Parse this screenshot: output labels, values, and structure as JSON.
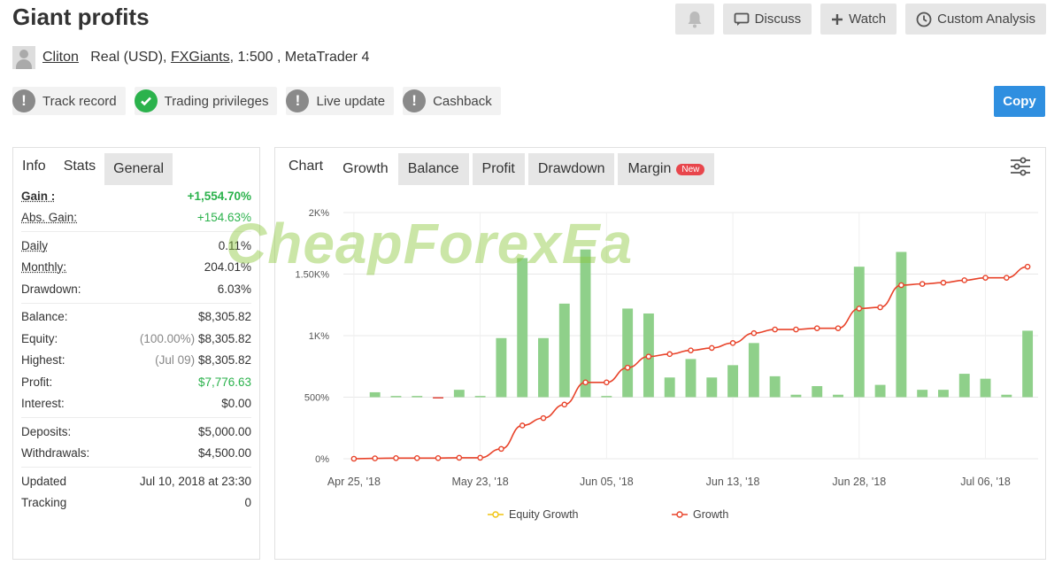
{
  "header": {
    "title": "Giant profits",
    "buttons": {
      "discuss": "Discuss",
      "watch": "Watch",
      "custom_analysis": "Custom Analysis"
    }
  },
  "account": {
    "user": "Cliton",
    "type": "Real (USD),",
    "broker": "FXGiants",
    "leverage_platform": ", 1:500 , MetaTrader 4"
  },
  "badges": [
    {
      "label": "Track record",
      "status": "warning"
    },
    {
      "label": "Trading privileges",
      "status": "ok"
    },
    {
      "label": "Live update",
      "status": "warning"
    },
    {
      "label": "Cashback",
      "status": "warning"
    }
  ],
  "copy_label": "Copy",
  "left_tabs": [
    "Info",
    "Stats",
    "General"
  ],
  "stats": {
    "gain": {
      "label": "Gain :",
      "value": "+1,554.70%"
    },
    "abs_gain": {
      "label": "Abs. Gain:",
      "value": "+154.63%"
    },
    "daily": {
      "label": "Daily",
      "value": "0.11%"
    },
    "monthly": {
      "label": "Monthly:",
      "value": "204.01%"
    },
    "drawdown": {
      "label": "Drawdown:",
      "value": "6.03%"
    },
    "balance": {
      "label": "Balance:",
      "value": "$8,305.82"
    },
    "equity": {
      "label": "Equity:",
      "prefix": "(100.00%)",
      "value": "$8,305.82"
    },
    "highest": {
      "label": "Highest:",
      "prefix": "(Jul 09)",
      "value": "$8,305.82"
    },
    "profit": {
      "label": "Profit:",
      "value": "$7,776.63"
    },
    "interest": {
      "label": "Interest:",
      "value": "$0.00"
    },
    "deposits": {
      "label": "Deposits:",
      "value": "$5,000.00"
    },
    "withdrawals": {
      "label": "Withdrawals:",
      "value": "$4,500.00"
    },
    "updated": {
      "label": "Updated",
      "value": "Jul 10, 2018 at 23:30"
    },
    "tracking": {
      "label": "Tracking",
      "value": "0"
    }
  },
  "right_tabs": {
    "label": "Chart",
    "tabs": [
      "Growth",
      "Balance",
      "Profit",
      "Drawdown",
      "Margin"
    ],
    "new_badge": "New"
  },
  "watermark": "CheapForexEa",
  "colors": {
    "accent": "#2f8fe0",
    "positive": "#2bb24c",
    "growth_line": "#e8432a",
    "equity_line": "#f1c40f",
    "bar_pos": "#8fd08a",
    "bar_neg": "#e0453a"
  },
  "chart_data": {
    "type": "bar",
    "ylim": [
      0,
      2000
    ],
    "y_ticks": [
      0,
      500,
      1000,
      1500,
      2000
    ],
    "y_tick_labels": [
      "0%",
      "500%",
      "1K%",
      "1.50K%",
      "2K%"
    ],
    "x_tick_labels": [
      {
        "index": 0,
        "label": "Apr 25, '18"
      },
      {
        "index": 6,
        "label": "May 23, '18"
      },
      {
        "index": 12,
        "label": "Jun 05, '18"
      },
      {
        "index": 18,
        "label": "Jun 13, '18"
      },
      {
        "index": 24,
        "label": "Jun 28, '18"
      },
      {
        "index": 30,
        "label": "Jul 06, '18"
      }
    ],
    "bars": [
      0,
      40,
      10,
      10,
      -10,
      60,
      10,
      480,
      1130,
      480,
      760,
      1200,
      10,
      720,
      680,
      160,
      310,
      160,
      260,
      440,
      170,
      20,
      90,
      20,
      1060,
      100,
      1180,
      60,
      60,
      190,
      150,
      20,
      540
    ],
    "series": [
      {
        "name": "Equity Growth",
        "values": []
      },
      {
        "name": "Growth",
        "values": [
          0,
          3,
          5,
          5,
          5,
          8,
          8,
          80,
          270,
          330,
          440,
          620,
          620,
          740,
          830,
          850,
          880,
          900,
          940,
          1020,
          1050,
          1050,
          1060,
          1060,
          1220,
          1230,
          1410,
          1420,
          1430,
          1450,
          1470,
          1470,
          1560
        ]
      }
    ]
  }
}
